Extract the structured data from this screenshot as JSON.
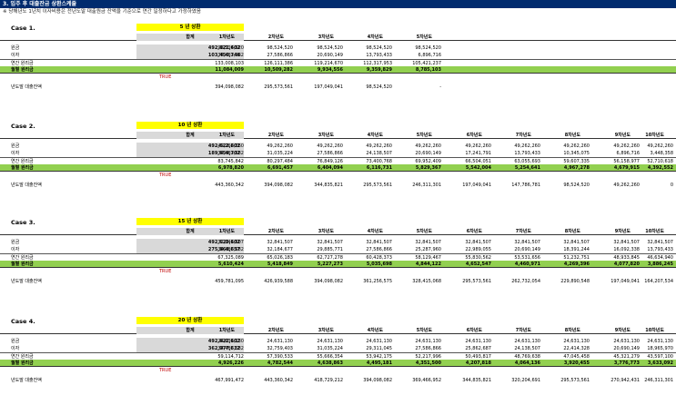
{
  "title": "3. 입주 후 대출잔금 상환스케줄",
  "subtitle": "※ 당해년도 1년치 이자비용은 전년도말 대출원금 잔액을 기준으로 연간 일정하다고 가정하였음",
  "labels": {
    "total": "합계",
    "principal": "원금",
    "interest": "이자",
    "annual": "연간 원리금",
    "monthly": "월별 원리금",
    "balance": "년도말 대출잔액",
    "true_text": "TRUE"
  },
  "cases": [
    {
      "title": "Case 1.",
      "period": "5   년 상환",
      "years": [
        "1차년도",
        "2차년도",
        "3차년도",
        "4차년도",
        "5차년도"
      ],
      "principal_total": "492,622,602",
      "interest_total": "103,450,746",
      "principal": [
        "98,524,520",
        "98,524,520",
        "98,524,520",
        "98,524,520",
        "98,524,520"
      ],
      "interest": [
        "34,483,582",
        "27,586,866",
        "20,690,149",
        "13,793,433",
        "6,896,716"
      ],
      "annual": [
        "133,008,103",
        "126,111,386",
        "119,214,670",
        "112,317,953",
        "105,421,237"
      ],
      "monthly": [
        "11,084,009",
        "10,509,282",
        "9,934,556",
        "9,359,829",
        "8,785,103"
      ],
      "balance_start": "394,098,082",
      "balance": [
        "295,573,561",
        "197,049,041",
        "98,524,520",
        "-"
      ]
    },
    {
      "title": "Case 2.",
      "period": "10   년 상환",
      "years": [
        "1차년도",
        "2차년도",
        "3차년도",
        "4차년도",
        "5차년도",
        "6차년도",
        "7차년도",
        "8차년도",
        "9차년도",
        "10차년도"
      ],
      "principal_total": "492,622,602",
      "interest_total": "189,659,702",
      "principal": [
        "49,262,260",
        "49,262,260",
        "49,262,260",
        "49,262,260",
        "49,262,260",
        "49,262,260",
        "49,262,260",
        "49,262,260",
        "49,262,260",
        "49,262,260"
      ],
      "interest": [
        "34,483,582",
        "31,035,224",
        "27,586,866",
        "24,138,507",
        "20,690,149",
        "17,241,791",
        "13,793,433",
        "10,345,075",
        "6,896,716",
        "3,448,358"
      ],
      "annual": [
        "83,745,842",
        "80,297,484",
        "76,849,126",
        "73,400,768",
        "69,952,409",
        "66,504,051",
        "63,055,693",
        "59,607,335",
        "56,158,977",
        "52,710,618"
      ],
      "monthly": [
        "6,978,820",
        "6,691,457",
        "6,404,094",
        "6,116,731",
        "5,829,367",
        "5,542,004",
        "5,254,641",
        "4,967,278",
        "4,679,915",
        "4,392,552"
      ],
      "balance_start": "443,360,342",
      "balance": [
        "394,098,082",
        "344,835,821",
        "295,573,561",
        "246,311,301",
        "197,049,041",
        "147,786,781",
        "98,524,520",
        "49,262,260",
        "0"
      ]
    },
    {
      "title": "Case 3.",
      "period": "15   년 상환",
      "years": [
        "1차년도",
        "2차년도",
        "3차년도",
        "4차년도",
        "5차년도",
        "6차년도",
        "7차년도",
        "8차년도",
        "9차년도",
        "10차년도"
      ],
      "principal_total": "492,622,602",
      "interest_total": "275,868,657",
      "principal": [
        "32,841,507",
        "32,841,507",
        "32,841,507",
        "32,841,507",
        "32,841,507",
        "32,841,507",
        "32,841,507",
        "32,841,507",
        "32,841,507",
        "32,841,507"
      ],
      "interest": [
        "34,483,582",
        "32,184,677",
        "29,885,771",
        "27,586,866",
        "25,287,960",
        "22,989,055",
        "20,690,149",
        "18,391,244",
        "16,092,338",
        "13,793,433"
      ],
      "annual": [
        "67,325,089",
        "65,026,183",
        "62,727,278",
        "60,428,373",
        "58,129,467",
        "55,830,562",
        "53,531,656",
        "51,232,751",
        "48,933,845",
        "46,634,940"
      ],
      "monthly": [
        "5,610,424",
        "5,418,849",
        "5,227,273",
        "5,035,698",
        "4,844,122",
        "4,652,547",
        "4,460,971",
        "4,269,396",
        "4,077,820",
        "3,886,245"
      ],
      "balance_start": "459,781,095",
      "balance": [
        "426,939,588",
        "394,098,082",
        "361,256,575",
        "328,415,068",
        "295,573,561",
        "262,732,054",
        "229,890,548",
        "197,049,041",
        "164,207,534"
      ]
    },
    {
      "title": "Case 4.",
      "period": "20   년 상환",
      "years": [
        "1차년도",
        "2차년도",
        "3차년도",
        "4차년도",
        "5차년도",
        "6차년도",
        "7차년도",
        "8차년도",
        "9차년도",
        "10차년도"
      ],
      "principal_total": "492,622,602",
      "interest_total": "362,077,612",
      "principal": [
        "24,631,130",
        "24,631,130",
        "24,631,130",
        "24,631,130",
        "24,631,130",
        "24,631,130",
        "24,631,130",
        "24,631,130",
        "24,631,130",
        "24,631,130"
      ],
      "interest": [
        "34,483,582",
        "32,759,403",
        "31,035,224",
        "29,311,045",
        "27,586,866",
        "25,862,687",
        "24,138,507",
        "22,414,328",
        "20,690,149",
        "18,965,970"
      ],
      "annual": [
        "59,114,712",
        "57,390,533",
        "55,666,354",
        "53,942,175",
        "52,217,996",
        "50,493,817",
        "48,769,638",
        "47,045,458",
        "45,321,279",
        "43,597,100"
      ],
      "monthly": [
        "4,926,226",
        "4,782,544",
        "4,638,863",
        "4,495,181",
        "4,351,500",
        "4,207,818",
        "4,064,136",
        "3,920,455",
        "3,776,773",
        "3,633,092"
      ],
      "balance_start": "467,991,472",
      "balance": [
        "443,360,342",
        "418,729,212",
        "394,098,082",
        "369,466,952",
        "344,835,821",
        "320,204,691",
        "295,573,561",
        "270,942,431",
        "246,311,301"
      ]
    }
  ]
}
